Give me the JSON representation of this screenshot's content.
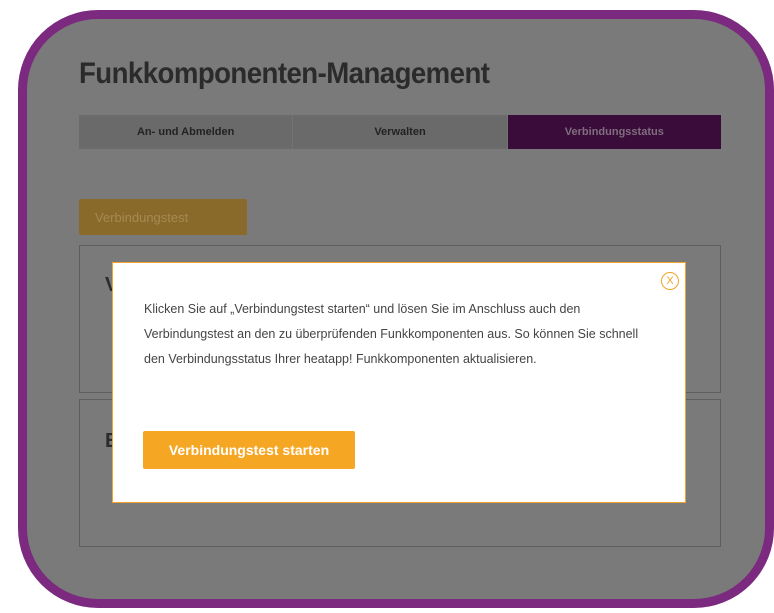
{
  "app": {
    "title": "Funkkomponenten-Management"
  },
  "tabs": [
    {
      "label": "An- und Abmelden",
      "active": false
    },
    {
      "label": "Verwalten",
      "active": false
    },
    {
      "label": "Verbindungsstatus",
      "active": true
    }
  ],
  "background_button": {
    "label": "Verbindungstest"
  },
  "panels": [
    {
      "heading_visible": "V"
    },
    {
      "heading_visible": "E"
    }
  ],
  "modal": {
    "close_label": "X",
    "text": "Klicken Sie auf „Verbindungstest starten“ und lösen Sie im Anschluss auch den Verbindungstest an den zu überprüfenden Funkkomponenten aus. So können Sie schnell den Verbindungsstatus Ihrer heatapp! Funkkomponenten aktualisieren.",
    "start_button_label": "Verbindungstest starten"
  },
  "colors": {
    "accent": "#f5a623",
    "brand": "#7b2a7f",
    "active_tab": "#3a0c3a",
    "overlay": "#7a7a7a"
  }
}
